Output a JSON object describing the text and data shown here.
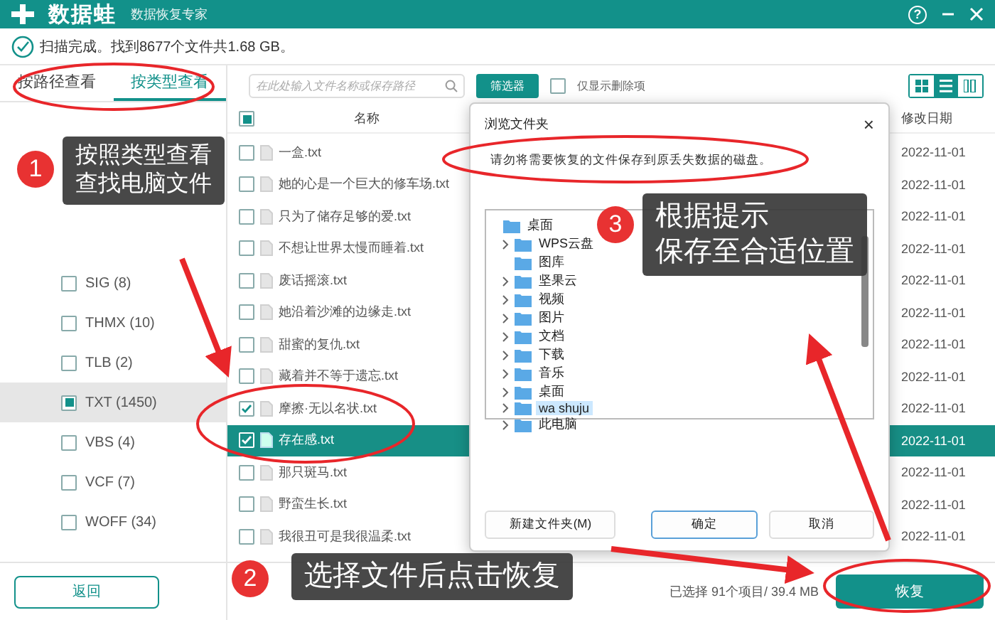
{
  "app": {
    "name": "数据蛙",
    "subtitle": "数据恢复专家",
    "help": "?"
  },
  "status": "扫描完成。找到8677个文件共1.68 GB。",
  "tabs": [
    {
      "label": "按路径查看",
      "selected": false
    },
    {
      "label": "按类型查看",
      "selected": true
    }
  ],
  "types": [
    {
      "label": "SIG (8)",
      "checked": false,
      "selected": false
    },
    {
      "label": "THMX (10)",
      "checked": false,
      "selected": false
    },
    {
      "label": "TLB (2)",
      "checked": false,
      "selected": false
    },
    {
      "label": "TXT (1450)",
      "checked": true,
      "selected": true
    },
    {
      "label": "VBS (4)",
      "checked": false,
      "selected": false
    },
    {
      "label": "VCF (7)",
      "checked": false,
      "selected": false
    },
    {
      "label": "WOFF (34)",
      "checked": false,
      "selected": false
    }
  ],
  "toolbar": {
    "search_placeholder": "在此处输入文件名称或保存路径",
    "filter_button": "筛选器",
    "deleted_only": {
      "label": "仅显示删除项",
      "checked": false
    },
    "views": [
      {
        "kind": "grid",
        "selected": false
      },
      {
        "kind": "list",
        "selected": true
      },
      {
        "kind": "columns",
        "selected": false
      }
    ]
  },
  "table": {
    "select_all_checked": true,
    "columns": [
      "名称",
      "修改日期"
    ],
    "rows": [
      {
        "name": "一盒.txt",
        "date": "2022-11-01",
        "checked": false,
        "selected": false
      },
      {
        "name": "她的心是一个巨大的修车场.txt",
        "date": "2022-11-01",
        "checked": false,
        "selected": false
      },
      {
        "name": "只为了储存足够的爱.txt",
        "date": "2022-11-01",
        "checked": false,
        "selected": false
      },
      {
        "name": "不想让世界太慢而睡着.txt",
        "date": "2022-11-01",
        "checked": false,
        "selected": false
      },
      {
        "name": "废话摇滚.txt",
        "date": "2022-11-01",
        "checked": false,
        "selected": false
      },
      {
        "name": "她沿着沙滩的边缘走.txt",
        "date": "2022-11-01",
        "checked": false,
        "selected": false
      },
      {
        "name": "甜蜜的复仇.txt",
        "date": "2022-11-01",
        "checked": false,
        "selected": false
      },
      {
        "name": "藏着并不等于遗忘.txt",
        "date": "2022-11-01",
        "checked": false,
        "selected": false
      },
      {
        "name": "摩擦·无以名状.txt",
        "date": "2022-11-01",
        "checked": true,
        "selected": false
      },
      {
        "name": "存在感.txt",
        "date": "2022-11-01",
        "checked": true,
        "selected": true
      },
      {
        "name": "那只斑马.txt",
        "date": "2022-11-01",
        "checked": false,
        "selected": false
      },
      {
        "name": "野蛮生长.txt",
        "date": "2022-11-01",
        "checked": false,
        "selected": false
      },
      {
        "name": "我很丑可是我很温柔.txt",
        "date": "2022-11-01",
        "checked": false,
        "selected": false
      }
    ]
  },
  "footer": {
    "back_button": "返回",
    "selection": "已选择 91个项目/ 39.4 MB",
    "recover_button": "恢复"
  },
  "dialog": {
    "title": "浏览文件夹",
    "close": "×",
    "message": "请勿将需要恢复的文件保存到原丢失数据的磁盘。",
    "tree": [
      {
        "label": "桌面",
        "expandable": false,
        "selected": false,
        "children": [
          {
            "label": "WPS云盘",
            "expandable": true,
            "selected": false
          },
          {
            "label": "图库",
            "expandable": false,
            "selected": false
          },
          {
            "label": "坚果云",
            "expandable": true,
            "selected": false
          },
          {
            "label": "视频",
            "expandable": true,
            "selected": false
          },
          {
            "label": "图片",
            "expandable": true,
            "selected": false
          },
          {
            "label": "文档",
            "expandable": true,
            "selected": false
          },
          {
            "label": "下载",
            "expandable": true,
            "selected": false
          },
          {
            "label": "音乐",
            "expandable": true,
            "selected": false
          },
          {
            "label": "桌面",
            "expandable": true,
            "selected": false
          },
          {
            "label": "wa shuju",
            "expandable": true,
            "selected": true
          },
          {
            "label": "此电脑",
            "expandable": true,
            "selected": false
          }
        ]
      }
    ],
    "buttons": [
      "新建文件夹(M)",
      "确定",
      "取消"
    ]
  },
  "callouts": [
    {
      "number": "1",
      "lines": [
        "按照类型查看",
        "查找电脑文件"
      ]
    },
    {
      "number": "2",
      "lines": [
        "选择文件后点击恢复"
      ]
    },
    {
      "number": "3",
      "lines": [
        "根据提示",
        "保存至合适位置"
      ]
    }
  ]
}
